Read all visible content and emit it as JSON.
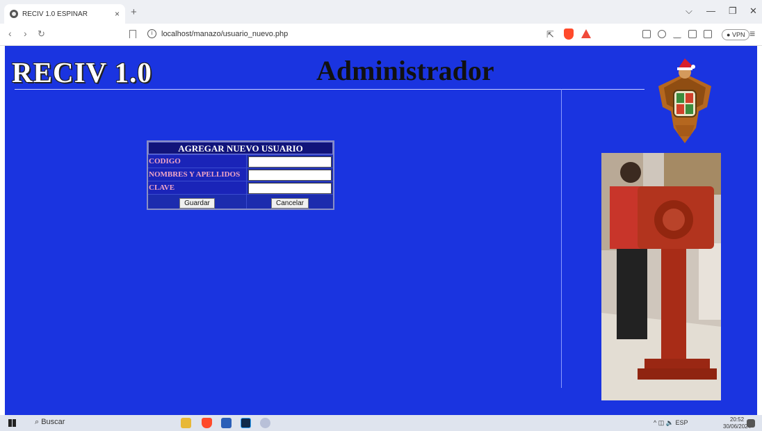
{
  "browser": {
    "tab_title": "RECIV 1.0 ESPINAR",
    "url": "localhost/manazo/usuario_nuevo.php",
    "vpn_label": "VPN"
  },
  "header": {
    "logo_text": "RECIV 1.0",
    "page_title": "Administrador"
  },
  "form": {
    "title": "AGREGAR NUEVO USUARIO",
    "fields": [
      {
        "label": "CODIGO",
        "value": ""
      },
      {
        "label": "NOMBRES Y APELLIDOS",
        "value": ""
      },
      {
        "label": "CLAVE",
        "value": ""
      }
    ],
    "save_label": "Guardar",
    "cancel_label": "Cancelar"
  },
  "taskbar": {
    "search_label": "Buscar",
    "lang": "ESP",
    "time": "20:52",
    "date": "30/06/2024"
  },
  "colors": {
    "page_background": "#1a34e0",
    "form_header": "#11147a",
    "label_text": "#f2a6c6"
  }
}
